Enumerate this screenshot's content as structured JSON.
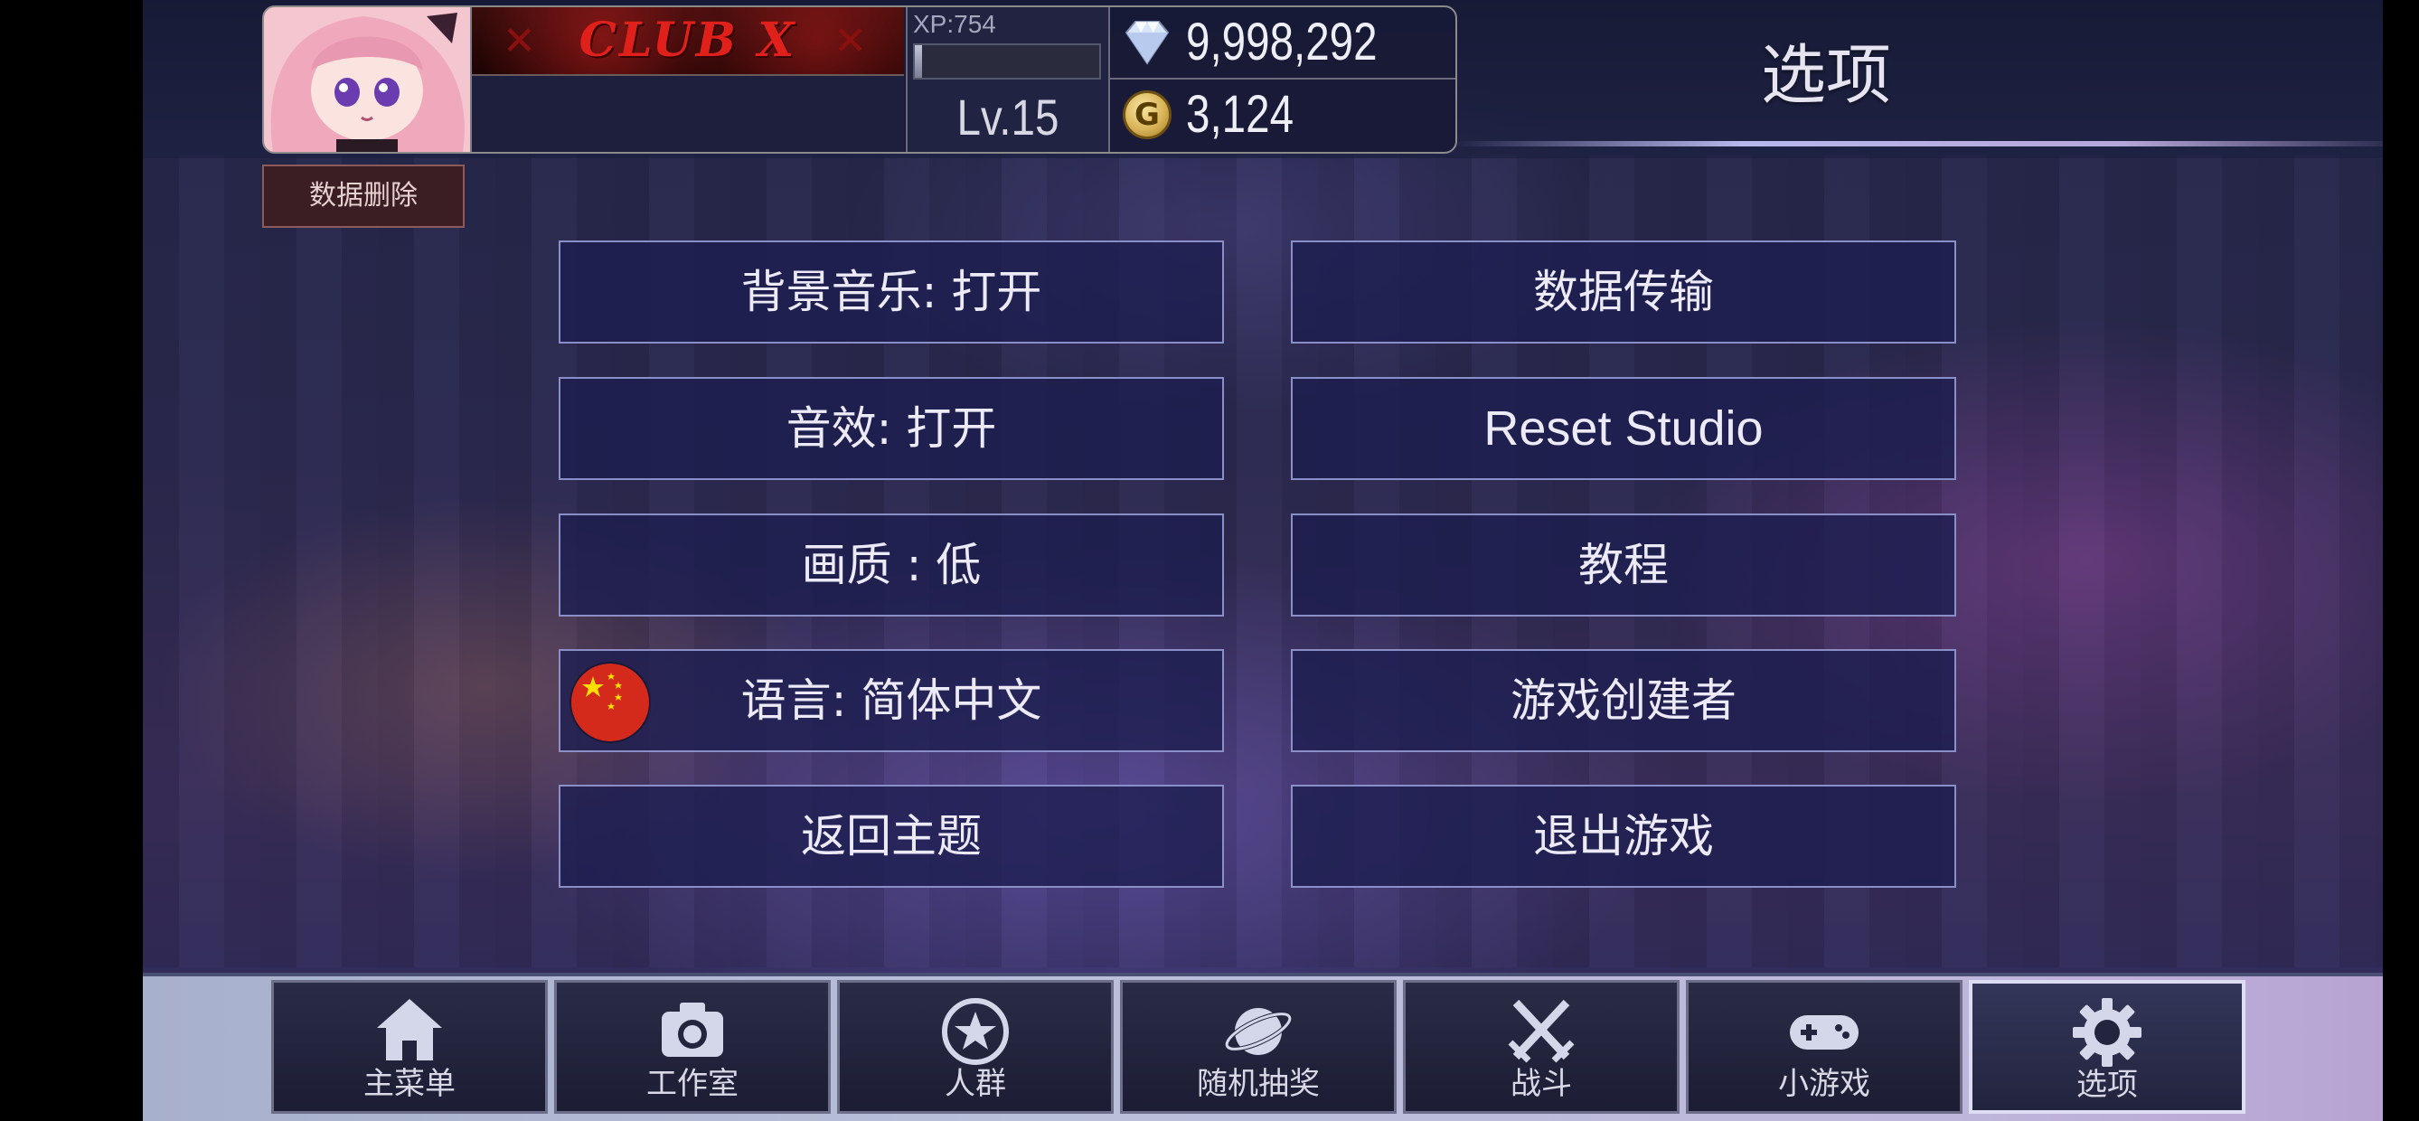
{
  "profile": {
    "banner_title": "CLUB X",
    "xp_label": "XP:754",
    "xp_progress": 0.04,
    "level": "Lv.15",
    "gems": "9,998,292",
    "gold": "3,124",
    "gold_icon_letter": "G"
  },
  "delete_data_label": "数据删除",
  "page_title": "选项",
  "options": {
    "bgm": "背景音乐: 打开",
    "sfx": "音效: 打开",
    "quality": "画质 : 低",
    "language": "语言: 简体中文",
    "return_title": "返回主题",
    "data_transfer": "数据传输",
    "reset_studio": "Reset Studio",
    "tutorial": "教程",
    "creators": "游戏创建者",
    "quit": "退出游戏"
  },
  "nav": [
    {
      "label": "主菜单",
      "icon": "home-icon"
    },
    {
      "label": "工作室",
      "icon": "camera-icon"
    },
    {
      "label": "人群",
      "icon": "star-icon"
    },
    {
      "label": "随机抽奖",
      "icon": "planet-icon"
    },
    {
      "label": "战斗",
      "icon": "crossed-swords-icon"
    },
    {
      "label": "小游戏",
      "icon": "gamepad-icon"
    },
    {
      "label": "选项",
      "icon": "gear-icon",
      "active": true
    }
  ],
  "colors": {
    "button_border": "#8b8fc8",
    "banner_red": "#e0201a",
    "flag_red": "#d42a1c",
    "flag_star": "#ffde00"
  }
}
